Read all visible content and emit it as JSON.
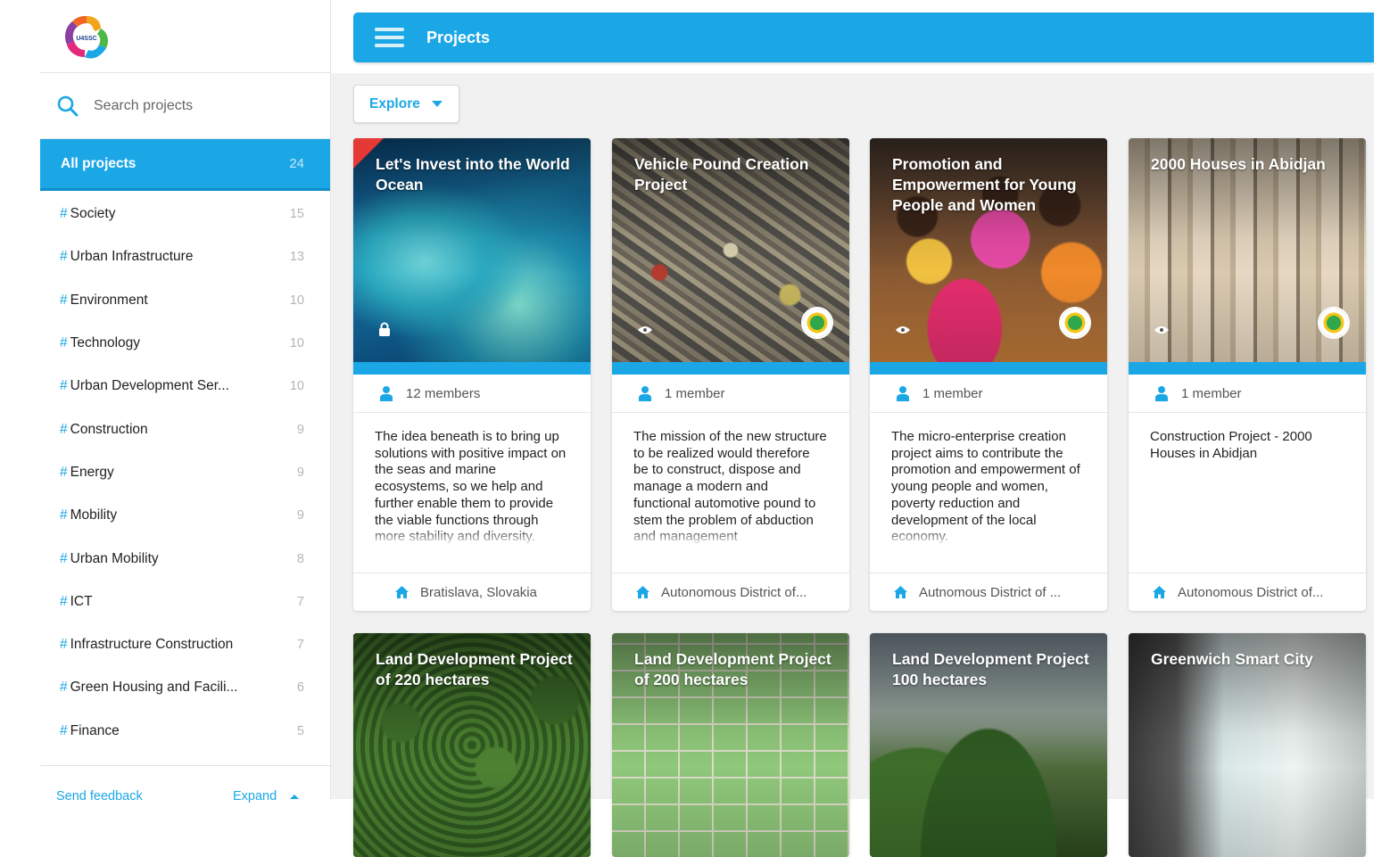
{
  "app": {
    "logo_text": "U4SSC"
  },
  "search": {
    "placeholder": "Search projects"
  },
  "all_projects": {
    "label": "All projects",
    "count": "24"
  },
  "tags": [
    {
      "label": "Society",
      "count": "15"
    },
    {
      "label": "Urban Infrastructure",
      "count": "13"
    },
    {
      "label": "Environment",
      "count": "10"
    },
    {
      "label": "Technology",
      "count": "10"
    },
    {
      "label": "Urban Development Ser...",
      "count": "10"
    },
    {
      "label": "Construction",
      "count": "9"
    },
    {
      "label": "Energy",
      "count": "9"
    },
    {
      "label": "Mobility",
      "count": "9"
    },
    {
      "label": "Urban Mobility",
      "count": "8"
    },
    {
      "label": "ICT",
      "count": "7"
    },
    {
      "label": "Infrastructure Construction",
      "count": "7"
    },
    {
      "label": "Green Housing and Facili...",
      "count": "6"
    },
    {
      "label": "Finance",
      "count": "5"
    }
  ],
  "tag_prefix": "#",
  "footer": {
    "feedback": "Send feedback",
    "expand": "Expand"
  },
  "header": {
    "title": "Projects"
  },
  "explore": {
    "label": "Explore"
  },
  "cards": [
    {
      "title": "Let's Invest into the World Ocean",
      "members": "12 members",
      "description": "The idea beneath is to bring up solutions with positive impact on the seas and marine ecosystems, so we help and further enable them to provide the viable functions through more stability and diversity.",
      "location": "Bratislava, Slovakia",
      "visibility": "lock-icon"
    },
    {
      "title": "Vehicle Pound Creation Project",
      "members": "1 member",
      "description": "The mission of the new structure to be realized would therefore be to construct, dispose and manage a modern and functional automotive pound to stem the problem of abduction and management",
      "location": "Autonomous District of...",
      "visibility": "eye-icon"
    },
    {
      "title": "Promotion and Empowerment for Young People and Women",
      "members": "1 member",
      "description": "The micro-enterprise creation project aims to contribute the promotion and empowerment of young people and women, poverty reduction and development of the local economy.",
      "location": "Autnomous District of ...",
      "visibility": "eye-icon"
    },
    {
      "title": "2000 Houses in Abidjan",
      "members": "1 member",
      "description": "Construction Project - 2000 Houses in Abidjan",
      "location": "Autonomous District of...",
      "visibility": "eye-icon"
    },
    {
      "title": "Land Development Project of 220 hectares"
    },
    {
      "title": "Land Development Project of 200 hectares"
    },
    {
      "title": "Land Development Project 100 hectares"
    },
    {
      "title": "Greenwich Smart City"
    }
  ],
  "colors": {
    "accent": "#1ba7e6",
    "accent_dark": "#0f8ecb",
    "badge_red": "#e53935"
  }
}
